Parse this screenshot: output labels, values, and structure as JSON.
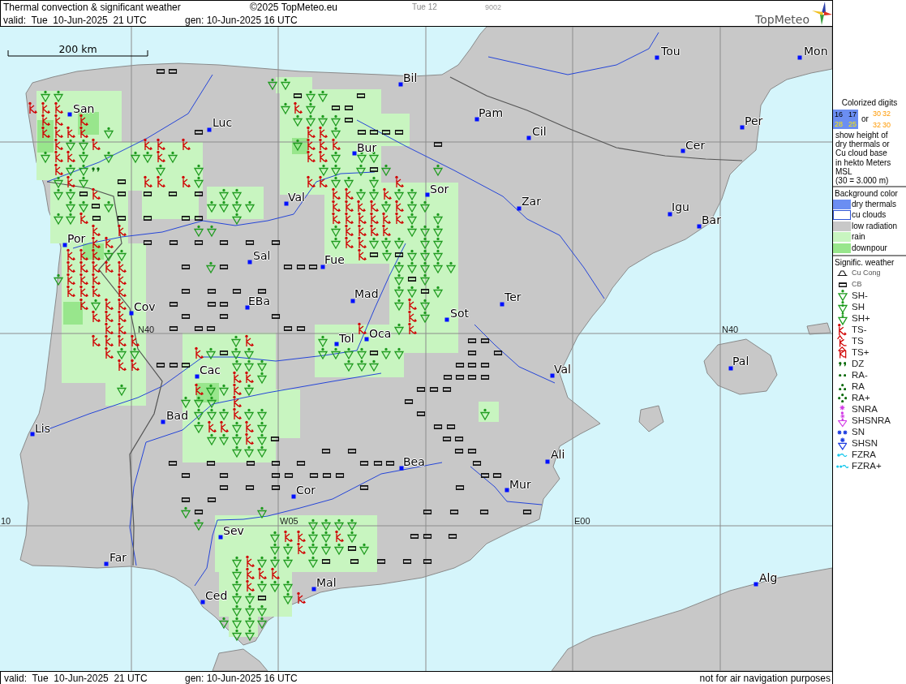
{
  "header": {
    "title": "Thermal convection & significant weather",
    "copyright": "©2025 TopMeteo.eu",
    "day_label": "Tue 12",
    "code": "9002",
    "valid": "valid:  Tue  10-Jun-2025  21 UTC",
    "generated": "gen: 10-Jun-2025 16 UTC",
    "logo": "TopMeteo"
  },
  "map": {
    "scale_label": "200 km",
    "grid_labels": [
      "N40",
      "N40",
      "10",
      "W05",
      "E00"
    ],
    "cities": [
      "Tou",
      "Mon",
      "Bil",
      "San",
      "Pam",
      "Per",
      "Luc",
      "Cil",
      "Cer",
      "Bur",
      "Sor",
      "Val",
      "Zar",
      "Igu",
      "Bar",
      "Por",
      "Sal",
      "Fue",
      "Mad",
      "Ter",
      "EBa",
      "Cov",
      "Sot",
      "Oca",
      "Tol",
      "Pal",
      "Val",
      "Cac",
      "Bad",
      "Lis",
      "Ali",
      "Bea",
      "Mur",
      "Cor",
      "Sev",
      "Far",
      "Alg",
      "Mal",
      "Ced"
    ],
    "weather_symbols": [
      {
        "kind": "cb"
      },
      {
        "kind": "cb"
      },
      {
        "kind": "shl"
      },
      {
        "kind": "shl"
      },
      {
        "kind": "shl"
      },
      {
        "kind": "shl"
      },
      {
        "kind": "cb"
      },
      {
        "kind": "shl"
      },
      {
        "kind": "shl"
      },
      {
        "kind": "cb"
      },
      {
        "kind": "tsl"
      },
      {
        "kind": "tsl"
      },
      {
        "kind": "tsl"
      },
      {
        "kind": "shl"
      },
      {
        "kind": "tsl"
      },
      {
        "kind": "shl"
      },
      {
        "kind": "cb"
      },
      {
        "kind": "cb"
      },
      {
        "kind": "tsl"
      },
      {
        "kind": "tsl"
      },
      {
        "kind": "tsl"
      },
      {
        "kind": "shl"
      },
      {
        "kind": "shl"
      },
      {
        "kind": "shl"
      },
      {
        "kind": "shl"
      },
      {
        "kind": "cb"
      },
      {
        "kind": "tsl"
      },
      {
        "kind": "tsl"
      },
      {
        "kind": "tsl"
      },
      {
        "kind": "tsl"
      },
      {
        "kind": "shl"
      },
      {
        "kind": "cb"
      },
      {
        "kind": "tsl"
      },
      {
        "kind": "tsl"
      },
      {
        "kind": "shl"
      },
      {
        "kind": "cb"
      },
      {
        "kind": "cb"
      },
      {
        "kind": "cb"
      },
      {
        "kind": "cb"
      },
      {
        "kind": "tsl"
      },
      {
        "kind": "shl"
      },
      {
        "kind": "shl"
      },
      {
        "kind": "tsl"
      },
      {
        "kind": "tsl"
      },
      {
        "kind": "tsl"
      },
      {
        "kind": "tsl"
      },
      {
        "kind": "shl"
      },
      {
        "kind": "tsl"
      },
      {
        "kind": "tsl"
      },
      {
        "kind": "tsl"
      },
      {
        "kind": "cb"
      },
      {
        "kind": "shl"
      },
      {
        "kind": "tsl"
      },
      {
        "kind": "tsl"
      },
      {
        "kind": "shl"
      },
      {
        "kind": "shl"
      },
      {
        "kind": "shl"
      },
      {
        "kind": "shl"
      },
      {
        "kind": "tsl"
      },
      {
        "kind": "shl"
      },
      {
        "kind": "tsl"
      },
      {
        "kind": "tsl"
      },
      {
        "kind": "shl"
      },
      {
        "kind": "shl"
      },
      {
        "kind": "shl"
      },
      {
        "kind": "tsl"
      },
      {
        "kind": "shl"
      },
      {
        "kind": "shl"
      },
      {
        "kind": "dz"
      },
      {
        "kind": "shl"
      },
      {
        "kind": "shl"
      },
      {
        "kind": "shl"
      },
      {
        "kind": "shl"
      },
      {
        "kind": "shl"
      },
      {
        "kind": "cb"
      },
      {
        "kind": "shl"
      },
      {
        "kind": "shl"
      },
      {
        "kind": "shl"
      },
      {
        "kind": "tsl"
      },
      {
        "kind": "shl"
      },
      {
        "kind": "cb"
      },
      {
        "kind": "tsl"
      },
      {
        "kind": "tsl"
      },
      {
        "kind": "tsl"
      },
      {
        "kind": "shl"
      },
      {
        "kind": "tsl"
      },
      {
        "kind": "tsl"
      },
      {
        "kind": "shl"
      },
      {
        "kind": "shl"
      },
      {
        "kind": "shl"
      },
      {
        "kind": "tsl"
      },
      {
        "kind": "shl"
      },
      {
        "kind": "shl"
      },
      {
        "kind": "cb"
      },
      {
        "kind": "tsl"
      },
      {
        "kind": "cb"
      },
      {
        "kind": "cb"
      },
      {
        "kind": "cb"
      },
      {
        "kind": "cb"
      },
      {
        "kind": "shl"
      },
      {
        "kind": "shl"
      },
      {
        "kind": "tsl"
      },
      {
        "kind": "tsl"
      },
      {
        "kind": "shl"
      },
      {
        "kind": "shl"
      },
      {
        "kind": "tsl"
      },
      {
        "kind": "shl"
      },
      {
        "kind": "shl"
      },
      {
        "kind": "shl"
      },
      {
        "kind": "shl"
      },
      {
        "kind": "cb"
      },
      {
        "kind": "shl"
      },
      {
        "kind": "shl"
      },
      {
        "kind": "shl"
      },
      {
        "kind": "shl"
      },
      {
        "kind": "shl"
      },
      {
        "kind": "tsl"
      },
      {
        "kind": "tsl"
      },
      {
        "kind": "tsl"
      },
      {
        "kind": "tsl"
      },
      {
        "kind": "shl"
      },
      {
        "kind": "tsl"
      },
      {
        "kind": "shl"
      },
      {
        "kind": "shl"
      },
      {
        "kind": "shl"
      },
      {
        "kind": "shl"
      },
      {
        "kind": "tsl"
      },
      {
        "kind": "cb"
      },
      {
        "kind": "cb"
      },
      {
        "kind": "cb"
      },
      {
        "kind": "cb"
      },
      {
        "kind": "cb"
      },
      {
        "kind": "shl"
      },
      {
        "kind": "tsl"
      },
      {
        "kind": "tsl"
      },
      {
        "kind": "tsl"
      },
      {
        "kind": "tsl"
      },
      {
        "kind": "tsl"
      },
      {
        "kind": "tsl"
      },
      {
        "kind": "shl"
      },
      {
        "kind": "shl"
      },
      {
        "kind": "tsl"
      },
      {
        "kind": "tsl"
      },
      {
        "kind": "shl"
      },
      {
        "kind": "shl"
      },
      {
        "kind": "shl"
      },
      {
        "kind": "tsl"
      },
      {
        "kind": "tsl"
      },
      {
        "kind": "tsl"
      },
      {
        "kind": "tsl"
      },
      {
        "kind": "shl"
      },
      {
        "kind": "shl"
      },
      {
        "kind": "shl"
      },
      {
        "kind": "tsl"
      },
      {
        "kind": "tsl"
      },
      {
        "kind": "cb"
      },
      {
        "kind": "cb"
      },
      {
        "kind": "cb"
      },
      {
        "kind": "cb"
      },
      {
        "kind": "cb"
      },
      {
        "kind": "cb"
      },
      {
        "kind": "shl"
      },
      {
        "kind": "tsl"
      },
      {
        "kind": "tsl"
      },
      {
        "kind": "shl"
      },
      {
        "kind": "shl"
      },
      {
        "kind": "shl"
      },
      {
        "kind": "shl"
      },
      {
        "kind": "shl"
      },
      {
        "kind": "tsl"
      },
      {
        "kind": "tsl"
      },
      {
        "kind": "tsl"
      },
      {
        "kind": "shl"
      },
      {
        "kind": "shl"
      },
      {
        "kind": "tsl"
      },
      {
        "kind": "cb"
      },
      {
        "kind": "shl"
      },
      {
        "kind": "cb"
      },
      {
        "kind": "shl"
      },
      {
        "kind": "shl"
      },
      {
        "kind": "shl"
      },
      {
        "kind": "tsl"
      },
      {
        "kind": "tsl"
      },
      {
        "kind": "tsl"
      },
      {
        "kind": "tsl"
      },
      {
        "kind": "tsl"
      },
      {
        "kind": "cb"
      },
      {
        "kind": "shl"
      },
      {
        "kind": "cb"
      },
      {
        "kind": "cb"
      },
      {
        "kind": "cb"
      },
      {
        "kind": "cb"
      },
      {
        "kind": "shl"
      },
      {
        "kind": "shl"
      },
      {
        "kind": "shl"
      },
      {
        "kind": "shl"
      },
      {
        "kind": "shl"
      },
      {
        "kind": "shl"
      },
      {
        "kind": "tsl"
      },
      {
        "kind": "tsl"
      },
      {
        "kind": "tsl"
      },
      {
        "kind": "tsl"
      },
      {
        "kind": "shl"
      },
      {
        "kind": "cb"
      },
      {
        "kind": "shl"
      },
      {
        "kind": "tsl"
      },
      {
        "kind": "tsl"
      },
      {
        "kind": "tsl"
      },
      {
        "kind": "tsl"
      },
      {
        "kind": "cb"
      },
      {
        "kind": "cb"
      },
      {
        "kind": "cb"
      },
      {
        "kind": "cb"
      },
      {
        "kind": "shl"
      },
      {
        "kind": "shl"
      },
      {
        "kind": "cb"
      },
      {
        "kind": "shl"
      },
      {
        "kind": "tsl"
      },
      {
        "kind": "shl"
      },
      {
        "kind": "tsl"
      },
      {
        "kind": "tsl"
      },
      {
        "kind": "cb"
      },
      {
        "kind": "cb"
      },
      {
        "kind": "cb"
      },
      {
        "kind": "shl"
      },
      {
        "kind": "tsl"
      },
      {
        "kind": "shl"
      },
      {
        "kind": "tsl"
      },
      {
        "kind": "tsl"
      },
      {
        "kind": "tsl"
      },
      {
        "kind": "cb"
      },
      {
        "kind": "cb"
      },
      {
        "kind": "cb"
      },
      {
        "kind": "tsl"
      },
      {
        "kind": "shl"
      },
      {
        "kind": "tsl"
      },
      {
        "kind": "tsl"
      },
      {
        "kind": "cb"
      },
      {
        "kind": "cb"
      },
      {
        "kind": "cb"
      },
      {
        "kind": "cb"
      },
      {
        "kind": "cb"
      },
      {
        "kind": "tsl"
      },
      {
        "kind": "shl"
      },
      {
        "kind": "tsl"
      },
      {
        "kind": "tsl"
      },
      {
        "kind": "tsl"
      },
      {
        "kind": "tsl"
      },
      {
        "kind": "tsl"
      },
      {
        "kind": "shl"
      },
      {
        "kind": "tsl"
      },
      {
        "kind": "shl"
      },
      {
        "kind": "cb"
      },
      {
        "kind": "cb"
      },
      {
        "kind": "tsl"
      },
      {
        "kind": "shl"
      },
      {
        "kind": "shl"
      },
      {
        "kind": "tsl"
      },
      {
        "kind": "shl"
      },
      {
        "kind": "cb"
      },
      {
        "kind": "shl"
      },
      {
        "kind": "shl"
      },
      {
        "kind": "shl"
      },
      {
        "kind": "shl"
      },
      {
        "kind": "shl"
      },
      {
        "kind": "shl"
      },
      {
        "kind": "cb"
      },
      {
        "kind": "shl"
      },
      {
        "kind": "shl"
      },
      {
        "kind": "cb"
      },
      {
        "kind": "cb"
      },
      {
        "kind": "tsl"
      },
      {
        "kind": "tsl"
      },
      {
        "kind": "cb"
      },
      {
        "kind": "cb"
      },
      {
        "kind": "cb"
      },
      {
        "kind": "shl"
      },
      {
        "kind": "shl"
      },
      {
        "kind": "shl"
      },
      {
        "kind": "shl"
      },
      {
        "kind": "shl"
      },
      {
        "kind": "shl"
      },
      {
        "kind": "cb"
      },
      {
        "kind": "cb"
      },
      {
        "kind": "cb"
      },
      {
        "kind": "tsl"
      },
      {
        "kind": "tsl"
      },
      {
        "kind": "shl"
      },
      {
        "kind": "cb"
      },
      {
        "kind": "cb"
      },
      {
        "kind": "cb"
      },
      {
        "kind": "cb"
      },
      {
        "kind": "shl"
      },
      {
        "kind": "tsl"
      },
      {
        "kind": "shl"
      },
      {
        "kind": "shl"
      },
      {
        "kind": "tsl"
      },
      {
        "kind": "shl"
      },
      {
        "kind": "cb"
      },
      {
        "kind": "cb"
      },
      {
        "kind": "cb"
      },
      {
        "kind": "shl"
      },
      {
        "kind": "shl"
      },
      {
        "kind": "shl"
      },
      {
        "kind": "tsl"
      },
      {
        "kind": "cb"
      },
      {
        "kind": "shl"
      },
      {
        "kind": "shl"
      },
      {
        "kind": "shl"
      },
      {
        "kind": "tsl"
      },
      {
        "kind": "shl"
      },
      {
        "kind": "shl"
      },
      {
        "kind": "cb"
      },
      {
        "kind": "shl"
      },
      {
        "kind": "shl"
      },
      {
        "kind": "tsl"
      },
      {
        "kind": "tsl"
      },
      {
        "kind": "shl"
      },
      {
        "kind": "tsl"
      },
      {
        "kind": "shl"
      },
      {
        "kind": "cb"
      },
      {
        "kind": "cb"
      },
      {
        "kind": "shl"
      },
      {
        "kind": "shl"
      },
      {
        "kind": "shl"
      },
      {
        "kind": "tsl"
      },
      {
        "kind": "shl"
      },
      {
        "kind": "cb"
      },
      {
        "kind": "cb"
      },
      {
        "kind": "cb"
      },
      {
        "kind": "shl"
      },
      {
        "kind": "shl"
      },
      {
        "kind": "shl"
      },
      {
        "kind": "cb"
      },
      {
        "kind": "cb"
      },
      {
        "kind": "cb"
      },
      {
        "kind": "cb"
      },
      {
        "kind": "cb"
      },
      {
        "kind": "cb"
      },
      {
        "kind": "cb"
      },
      {
        "kind": "cb"
      },
      {
        "kind": "cb"
      },
      {
        "kind": "cb"
      },
      {
        "kind": "cb"
      },
      {
        "kind": "cb"
      },
      {
        "kind": "cb"
      },
      {
        "kind": "cb"
      },
      {
        "kind": "cb"
      },
      {
        "kind": "cb"
      },
      {
        "kind": "cb"
      },
      {
        "kind": "cb"
      },
      {
        "kind": "cb"
      },
      {
        "kind": "cb"
      },
      {
        "kind": "cb"
      },
      {
        "kind": "cb"
      },
      {
        "kind": "cb"
      },
      {
        "kind": "cb"
      },
      {
        "kind": "cb"
      },
      {
        "kind": "cb"
      },
      {
        "kind": "cb"
      },
      {
        "kind": "cb"
      },
      {
        "kind": "cb"
      },
      {
        "kind": "shl"
      },
      {
        "kind": "cb"
      },
      {
        "kind": "shl"
      },
      {
        "kind": "cb"
      },
      {
        "kind": "cb"
      },
      {
        "kind": "cb"
      },
      {
        "kind": "cb"
      },
      {
        "kind": "shl"
      },
      {
        "kind": "shl"
      },
      {
        "kind": "shl"
      },
      {
        "kind": "shl"
      },
      {
        "kind": "shl"
      },
      {
        "kind": "shl"
      },
      {
        "kind": "tsl"
      },
      {
        "kind": "tsl"
      },
      {
        "kind": "shl"
      },
      {
        "kind": "shl"
      },
      {
        "kind": "tsl"
      },
      {
        "kind": "shl"
      },
      {
        "kind": "cb"
      },
      {
        "kind": "cb"
      },
      {
        "kind": "cb"
      },
      {
        "kind": "shl"
      },
      {
        "kind": "shl"
      },
      {
        "kind": "tsl"
      },
      {
        "kind": "shl"
      },
      {
        "kind": "shl"
      },
      {
        "kind": "shl"
      },
      {
        "kind": "cb"
      },
      {
        "kind": "shl"
      },
      {
        "kind": "shl"
      },
      {
        "kind": "tsl"
      },
      {
        "kind": "shl"
      },
      {
        "kind": "shl"
      },
      {
        "kind": "shl"
      },
      {
        "kind": "shl"
      },
      {
        "kind": "cb"
      },
      {
        "kind": "cb"
      },
      {
        "kind": "cb"
      },
      {
        "kind": "cb"
      },
      {
        "kind": "cb"
      },
      {
        "kind": "shl"
      },
      {
        "kind": "tsl"
      },
      {
        "kind": "tsl"
      },
      {
        "kind": "tsl"
      },
      {
        "kind": "shl"
      },
      {
        "kind": "tsl"
      },
      {
        "kind": "shl"
      },
      {
        "kind": "shl"
      },
      {
        "kind": "shl"
      },
      {
        "kind": "shl"
      },
      {
        "kind": "shl"
      },
      {
        "kind": "cb"
      },
      {
        "kind": "shl"
      },
      {
        "kind": "tsl"
      },
      {
        "kind": "shl"
      },
      {
        "kind": "shl"
      },
      {
        "kind": "shl"
      },
      {
        "kind": "shl"
      },
      {
        "kind": "shl"
      },
      {
        "kind": "shl"
      },
      {
        "kind": "shl"
      },
      {
        "kind": "shl"
      },
      {
        "kind": "shl"
      }
    ]
  },
  "legend": {
    "digits_title": "Colorized digits",
    "digits_sample": {
      "thermal_rows": [
        [
          "16",
          "17"
        ],
        [
          "28",
          "25"
        ]
      ],
      "or": "or",
      "cloud_rows": [
        [
          "30",
          "32"
        ],
        [
          "32",
          "30"
        ]
      ]
    },
    "description_lines": [
      "show height of",
      "dry thermals or",
      "Cu cloud base",
      "in hekto Meters",
      "MSL",
      "(30 = 3.000 m)"
    ],
    "background_title": "Background color",
    "background_items": [
      {
        "label": "dry thermals",
        "color": "#6b8ef2",
        "outlined": false
      },
      {
        "label": "cu clouds",
        "color": "#ffffff",
        "outlined": true
      },
      {
        "label": "low radiation",
        "color": "#c8c8c8",
        "outlined": false
      },
      {
        "label": "rain",
        "color": "#c8f5c0",
        "outlined": false
      },
      {
        "label": "downpour",
        "color": "#98e68c",
        "outlined": false
      }
    ],
    "weather_title": "Signific. weather",
    "weather_items": [
      {
        "label": "Cu Cong",
        "kind": "cucong"
      },
      {
        "label": "CB",
        "kind": "cb"
      },
      {
        "label": "SH-",
        "kind": "shl"
      },
      {
        "label": "SH",
        "kind": "sh"
      },
      {
        "label": "SH+",
        "kind": "shh"
      },
      {
        "label": "TS-",
        "kind": "tsl"
      },
      {
        "label": "TS",
        "kind": "ts"
      },
      {
        "label": "TS+",
        "kind": "tsh"
      },
      {
        "label": "DZ",
        "kind": "dz"
      },
      {
        "label": "RA-",
        "kind": "ral"
      },
      {
        "label": "RA",
        "kind": "ra"
      },
      {
        "label": "RA+",
        "kind": "rah"
      },
      {
        "label": "SNRA",
        "kind": "snra"
      },
      {
        "label": "SHSNRA",
        "kind": "shsnra"
      },
      {
        "label": "SN",
        "kind": "sn"
      },
      {
        "label": "SHSN",
        "kind": "shsn"
      },
      {
        "label": "FZRA",
        "kind": "fzra"
      },
      {
        "label": "FZRA+",
        "kind": "fzrah"
      }
    ]
  },
  "footer": {
    "valid": "valid:  Tue  10-Jun-2025  21 UTC",
    "generated": "gen: 10-Jun-2025 16 UTC",
    "disclaimer": "not for air navigation purposes"
  }
}
